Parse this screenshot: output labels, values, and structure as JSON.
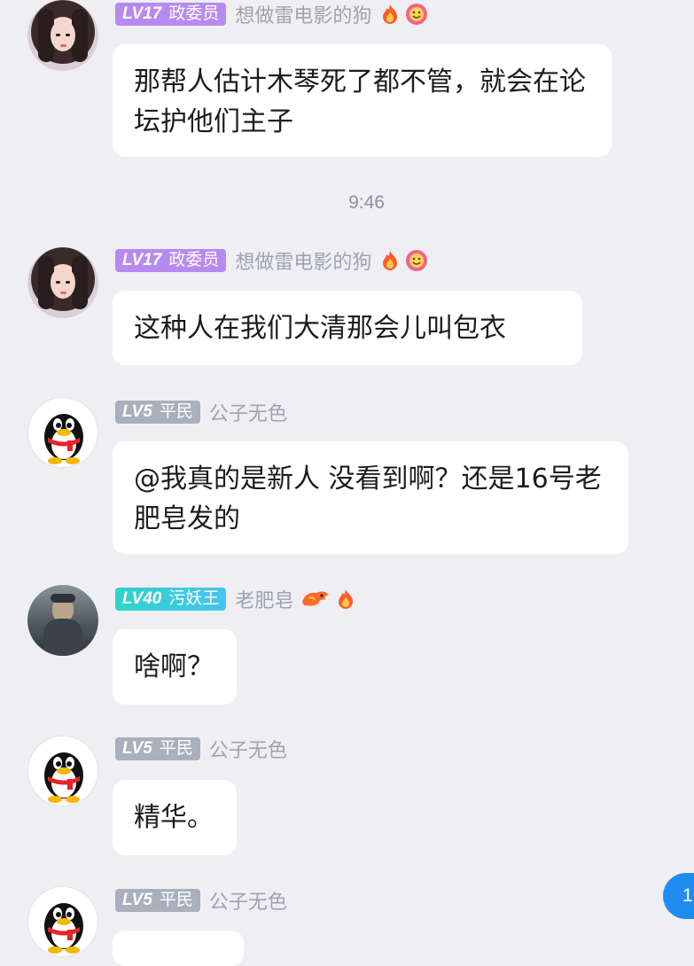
{
  "timestamp": "9:46",
  "messages": [
    {
      "level": "LV17",
      "title": "政委员",
      "name": "想做雷电影的狗",
      "text": "那帮人估计木琴死了都不管，就会在论坛护他们主子",
      "icons": [
        "fire-icon",
        "smile-flower-icon"
      ]
    },
    {
      "level": "LV17",
      "title": "政委员",
      "name": "想做雷电影的狗",
      "text": "这种人在我们大清那会儿叫包衣",
      "icons": [
        "fire-icon",
        "smile-flower-icon"
      ]
    },
    {
      "level": "LV5",
      "title": "平民",
      "name": "公子无色",
      "text": "@我真的是新人 没看到啊？还是16号老肥皂发的"
    },
    {
      "level": "LV40",
      "title": "污妖王",
      "name": "老肥皂",
      "text": "啥啊？",
      "icons": [
        "dragon-icon",
        "fire-icon"
      ]
    },
    {
      "level": "LV5",
      "title": "平民",
      "name": "公子无色",
      "text": "精华。"
    },
    {
      "level": "LV5",
      "title": "平民",
      "name": "公子无色",
      "text": ""
    }
  ],
  "unread_count": "1",
  "colors": {
    "background": "#efeff3",
    "badge_purple": "#b78af0",
    "badge_gray": "#a9afbd",
    "badge_teal": "#2fd3c9",
    "unread_blue": "#1f8cf0"
  }
}
